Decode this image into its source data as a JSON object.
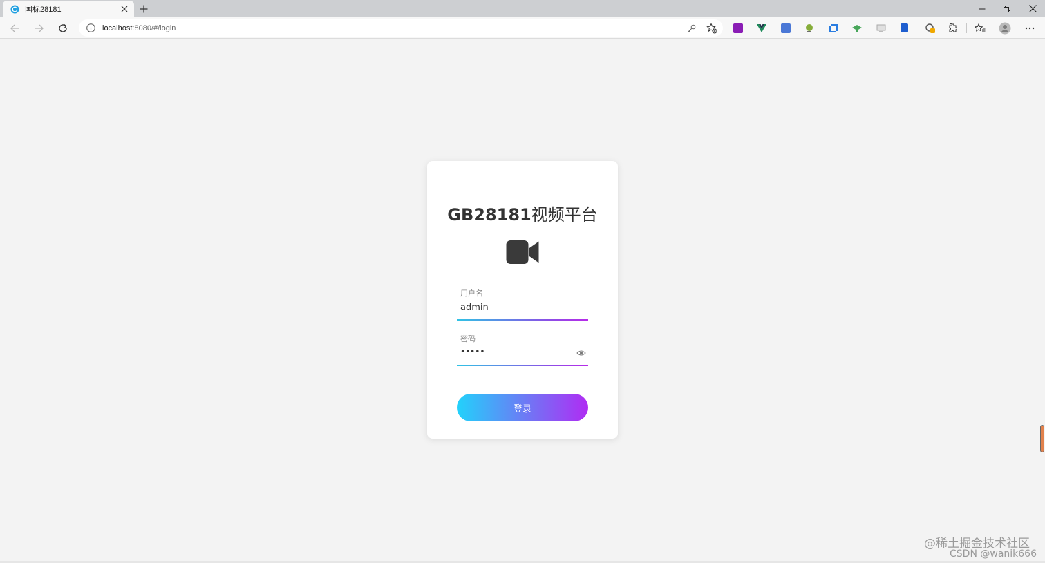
{
  "browser": {
    "tab_title": "国标28181",
    "url_host": "localhost",
    "url_rest": ":8080/#/login"
  },
  "login": {
    "title_en": "GB28181",
    "title_zh": "视频平台",
    "username_label": "用户名",
    "username_value": "admin",
    "password_label": "密码",
    "password_value": "•••••",
    "submit_label": "登录"
  },
  "watermark": {
    "line1": "@稀土掘金技术社区",
    "line2": "CSDN @wanik666"
  },
  "icons": [
    "favicon-icon",
    "close-icon",
    "plus-icon",
    "minimize-icon",
    "restore-icon",
    "back-icon",
    "forward-icon",
    "reload-icon",
    "info-icon",
    "key-icon",
    "favorite-add-icon",
    "extensions-icon",
    "favorites-icon",
    "profile-icon",
    "more-icon",
    "video-camera-icon",
    "eye-icon"
  ],
  "colors": {
    "accent_start": "#22d2fb",
    "accent_end": "#b02cf3"
  }
}
